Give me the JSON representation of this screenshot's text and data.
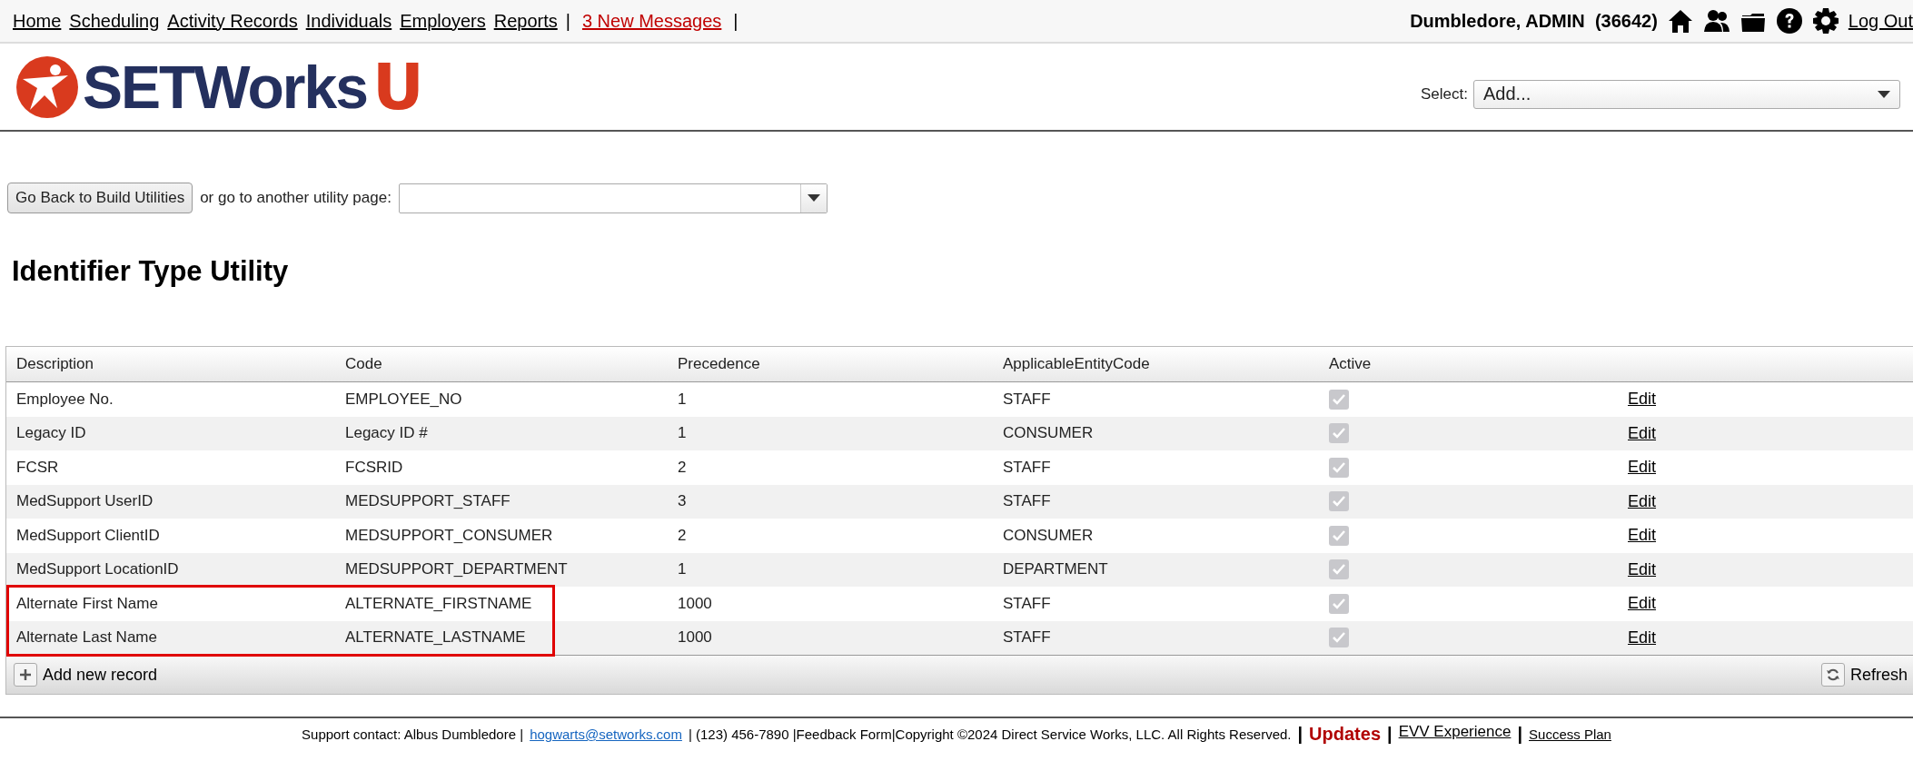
{
  "top_nav": {
    "items": [
      {
        "kind": "link",
        "text": "Home"
      },
      {
        "kind": "link",
        "text": "Scheduling"
      },
      {
        "kind": "link",
        "text": "Activity Records"
      },
      {
        "kind": "link",
        "text": "Individuals"
      },
      {
        "kind": "link",
        "text": "Employers"
      },
      {
        "kind": "link",
        "text": "Reports"
      },
      {
        "kind": "separator",
        "text": "|"
      },
      {
        "kind": "alert",
        "text": "3 New Messages"
      },
      {
        "kind": "separator",
        "text": "|"
      }
    ],
    "user": "Dumbledore, ADMIN",
    "user_id": "(36642)",
    "logout": "Log Out"
  },
  "logo": {
    "name": "SETWorks",
    "suffix": "U"
  },
  "select": {
    "label": "Select:",
    "value": "Add..."
  },
  "utility_bar": {
    "back_button": "Go Back to Build Utilities",
    "prompt": "or go to another utility page:"
  },
  "title": "Identifier Type Utility",
  "table": {
    "columns": [
      "Description",
      "Code",
      "Precedence",
      "ApplicableEntityCode",
      "Active"
    ],
    "rows": [
      {
        "description": "Employee No.",
        "code": "EMPLOYEE_NO",
        "precedence": "1",
        "entity": "STAFF",
        "active": true,
        "action": "Edit",
        "highlighted": false
      },
      {
        "description": "Legacy ID",
        "code": "Legacy ID #",
        "precedence": "1",
        "entity": "CONSUMER",
        "active": true,
        "action": "Edit",
        "highlighted": false
      },
      {
        "description": "FCSR",
        "code": "FCSRID",
        "precedence": "2",
        "entity": "STAFF",
        "active": true,
        "action": "Edit",
        "highlighted": false
      },
      {
        "description": "MedSupport UserID",
        "code": "MEDSUPPORT_STAFF",
        "precedence": "3",
        "entity": "STAFF",
        "active": true,
        "action": "Edit",
        "highlighted": false
      },
      {
        "description": "MedSupport ClientID",
        "code": "MEDSUPPORT_CONSUMER",
        "precedence": "2",
        "entity": "CONSUMER",
        "active": true,
        "action": "Edit",
        "highlighted": false
      },
      {
        "description": "MedSupport LocationID",
        "code": "MEDSUPPORT_DEPARTMENT",
        "precedence": "1",
        "entity": "DEPARTMENT",
        "active": true,
        "action": "Edit",
        "highlighted": false
      },
      {
        "description": "Alternate First Name",
        "code": "ALTERNATE_FIRSTNAME",
        "precedence": "1000",
        "entity": "STAFF",
        "active": true,
        "action": "Edit",
        "highlighted": true
      },
      {
        "description": "Alternate Last Name",
        "code": "ALTERNATE_LASTNAME",
        "precedence": "1000",
        "entity": "STAFF",
        "active": true,
        "action": "Edit",
        "highlighted": true
      }
    ],
    "add_button": "Add new record",
    "refresh_button": "Refresh"
  },
  "footer": [
    {
      "kind": "text",
      "text": "Support contact: Albus Dumbledore |"
    },
    {
      "kind": "link",
      "text": "hogwarts@setworks.com"
    },
    {
      "kind": "text",
      "text": "| (123) 456-7890 |Feedback Form|Copyright ©2024 Direct Service Works, LLC. All Rights Reserved."
    },
    {
      "kind": "separator",
      "text": "|"
    },
    {
      "kind": "updates",
      "text": "Updates"
    },
    {
      "kind": "separator",
      "text": "|"
    },
    {
      "kind": "link_large",
      "text": "EVV Experience"
    },
    {
      "kind": "separator",
      "text": "|"
    },
    {
      "kind": "link",
      "text": "Success Plan"
    }
  ]
}
